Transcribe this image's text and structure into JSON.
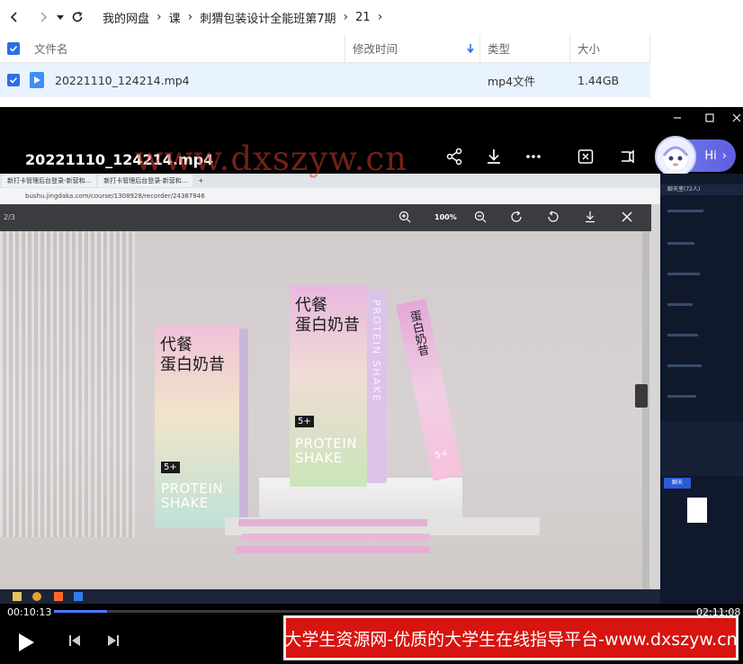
{
  "breadcrumb": [
    "我的网盘",
    "课",
    "刺猬包装设计全能班第7期",
    "21"
  ],
  "columns": {
    "name": "文件名",
    "mtime": "修改时间",
    "type": "类型",
    "size": "大小"
  },
  "file": {
    "name": "20221110_124214.mp4",
    "type": "mp4文件",
    "size": "1.44GB"
  },
  "player": {
    "title": "20221110_124214.mp4",
    "watermark": "www.dxszyw.cn",
    "assistant_label": "Hi",
    "current_time": "00:10:13",
    "total_time": "02:11:08",
    "progress": 0.078
  },
  "screen": {
    "tab1": "新打卡管理后台登录-新营和...",
    "tab2": "新打卡管理后台登录-新营和...",
    "url": "bushu.jingdaka.com/course/1308928/recorder/24387846",
    "page_counter": "2/3",
    "zoom": "100%",
    "product": {
      "cn_line1": "代餐",
      "cn_line2": "蛋白奶昔",
      "en_line1": "PROTEIN",
      "en_line2": "SHAKE",
      "badge": "5+",
      "side_text": "PROTEIN SHAKE"
    },
    "chat_title": "聊天室(72人)",
    "chat_send": "聊天"
  },
  "banner": "大学生资源网-优质的大学生在线指导平台-www.dxszyw.cn",
  "colors": {
    "accent": "#2b6fe6",
    "selection": "#e9f3ff",
    "banner": "#d7140f"
  }
}
